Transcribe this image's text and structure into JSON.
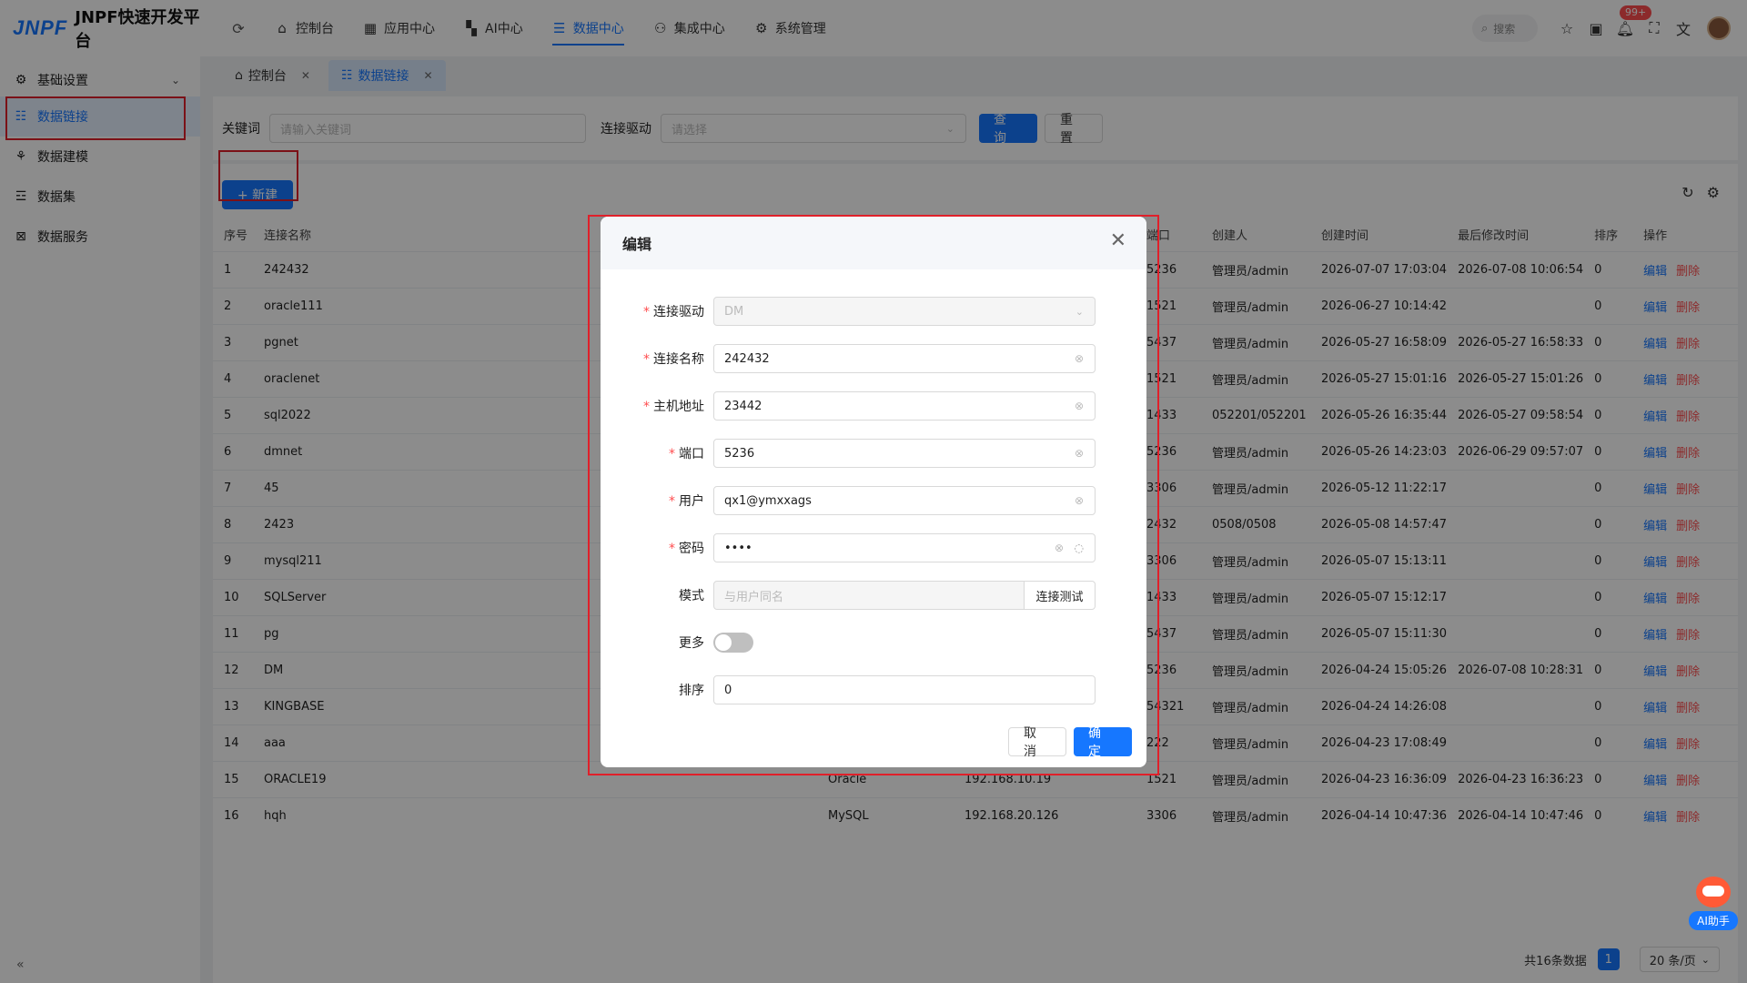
{
  "app": {
    "logo_mark": "JNPF",
    "title": "JNPF快速开发平台"
  },
  "nav": {
    "items": [
      {
        "label": "控制台",
        "icon": "home-icon"
      },
      {
        "label": "应用中心",
        "icon": "grid-icon"
      },
      {
        "label": "AI中心",
        "icon": "ai-icon"
      },
      {
        "label": "数据中心",
        "icon": "database-icon",
        "active": true
      },
      {
        "label": "集成中心",
        "icon": "integration-icon"
      },
      {
        "label": "系统管理",
        "icon": "gear-icon"
      }
    ]
  },
  "topbar": {
    "search_placeholder": "搜索",
    "notification_badge": "99+"
  },
  "sidebar": {
    "group_label": "基础设置",
    "items": [
      {
        "label": "数据链接",
        "active": true
      },
      {
        "label": "数据建模"
      },
      {
        "label": "数据集"
      },
      {
        "label": "数据服务"
      }
    ]
  },
  "tabs": [
    {
      "label": "控制台"
    },
    {
      "label": "数据链接",
      "active": true
    }
  ],
  "filter": {
    "keyword_label": "关键词",
    "keyword_placeholder": "请输入关键词",
    "driver_label": "连接驱动",
    "driver_placeholder": "请选择",
    "query_label": "查 询",
    "reset_label": "重 置"
  },
  "toolbar": {
    "new_label": "+ 新建"
  },
  "table": {
    "columns": [
      "序号",
      "连接名称",
      "",
      "",
      "端口",
      "创建人",
      "创建时间",
      "最后修改时间",
      "排序",
      "操作"
    ],
    "edit_label": "编辑",
    "delete_label": "删除",
    "rows": [
      {
        "no": "1",
        "name": "242432",
        "driver": "",
        "host": "",
        "port": "5236",
        "creator": "管理员/admin",
        "created": "2026-07-07 17:03:04",
        "modified": "2026-07-08 10:06:54",
        "sort": "0"
      },
      {
        "no": "2",
        "name": "oracle111",
        "driver": "",
        "host": "",
        "port": "1521",
        "creator": "管理员/admin",
        "created": "2026-06-27 10:14:42",
        "modified": "",
        "sort": "0"
      },
      {
        "no": "3",
        "name": "pgnet",
        "driver": "",
        "host": "",
        "port": "5437",
        "creator": "管理员/admin",
        "created": "2026-05-27 16:58:09",
        "modified": "2026-05-27 16:58:33",
        "sort": "0"
      },
      {
        "no": "4",
        "name": "oraclenet",
        "driver": "",
        "host": "",
        "port": "1521",
        "creator": "管理员/admin",
        "created": "2026-05-27 15:01:16",
        "modified": "2026-05-27 15:01:26",
        "sort": "0"
      },
      {
        "no": "5",
        "name": "sql2022",
        "driver": "",
        "host": "",
        "port": "1433",
        "creator": "052201/052201",
        "created": "2026-05-26 16:35:44",
        "modified": "2026-05-27 09:58:54",
        "sort": "0"
      },
      {
        "no": "6",
        "name": "dmnet",
        "driver": "",
        "host": "",
        "port": "5236",
        "creator": "管理员/admin",
        "created": "2026-05-26 14:23:03",
        "modified": "2026-06-29 09:57:07",
        "sort": "0"
      },
      {
        "no": "7",
        "name": "45",
        "driver": "",
        "host": "",
        "port": "3306",
        "creator": "管理员/admin",
        "created": "2026-05-12 11:22:17",
        "modified": "",
        "sort": "0"
      },
      {
        "no": "8",
        "name": "2423",
        "driver": "",
        "host": "",
        "port": "2432",
        "creator": "0508/0508",
        "created": "2026-05-08 14:57:47",
        "modified": "",
        "sort": "0"
      },
      {
        "no": "9",
        "name": "mysql211",
        "driver": "",
        "host": "",
        "port": "3306",
        "creator": "管理员/admin",
        "created": "2026-05-07 15:13:11",
        "modified": "",
        "sort": "0"
      },
      {
        "no": "10",
        "name": "SQLServer",
        "driver": "",
        "host": "",
        "port": "1433",
        "creator": "管理员/admin",
        "created": "2026-05-07 15:12:17",
        "modified": "",
        "sort": "0"
      },
      {
        "no": "11",
        "name": "pg",
        "driver": "",
        "host": "",
        "port": "5437",
        "creator": "管理员/admin",
        "created": "2026-05-07 15:11:30",
        "modified": "",
        "sort": "0"
      },
      {
        "no": "12",
        "name": "DM",
        "driver": "",
        "host": "",
        "port": "5236",
        "creator": "管理员/admin",
        "created": "2026-04-24 15:05:26",
        "modified": "2026-07-08 10:28:31",
        "sort": "0"
      },
      {
        "no": "13",
        "name": "KINGBASE",
        "driver": "",
        "host": "",
        "port": "54321",
        "creator": "管理员/admin",
        "created": "2026-04-24 14:26:08",
        "modified": "",
        "sort": "0"
      },
      {
        "no": "14",
        "name": "aaa",
        "driver": "",
        "host": "",
        "port": "222",
        "creator": "管理员/admin",
        "created": "2026-04-23 17:08:49",
        "modified": "",
        "sort": "0"
      },
      {
        "no": "15",
        "name": "ORACLE19",
        "driver": "Oracle",
        "host": "192.168.10.19",
        "port": "1521",
        "creator": "管理员/admin",
        "created": "2026-04-23 16:36:09",
        "modified": "2026-04-23 16:36:23",
        "sort": "0"
      },
      {
        "no": "16",
        "name": "hqh",
        "driver": "MySQL",
        "host": "192.168.20.126",
        "port": "3306",
        "creator": "管理员/admin",
        "created": "2026-04-14 10:47:36",
        "modified": "2026-04-14 10:47:46",
        "sort": "0"
      }
    ]
  },
  "pagination": {
    "total_label": "共16条数据",
    "current_page": "1",
    "page_size": "20 条/页"
  },
  "modal": {
    "title": "编辑",
    "fields": {
      "driver_label": "连接驱动",
      "driver_value": "DM",
      "name_label": "连接名称",
      "name_value": "242432",
      "host_label": "主机地址",
      "host_value": "23442",
      "port_label": "端口",
      "port_value": "5236",
      "user_label": "用户",
      "user_value": "qx1@ymxxags",
      "password_label": "密码",
      "password_value": "••••",
      "schema_label": "模式",
      "schema_placeholder": "与用户同名",
      "test_label": "连接测试",
      "more_label": "更多",
      "sort_label": "排序",
      "sort_value": "0"
    },
    "cancel_label": "取 消",
    "ok_label": "确 定"
  },
  "ai_helper": {
    "label": "AI助手"
  }
}
